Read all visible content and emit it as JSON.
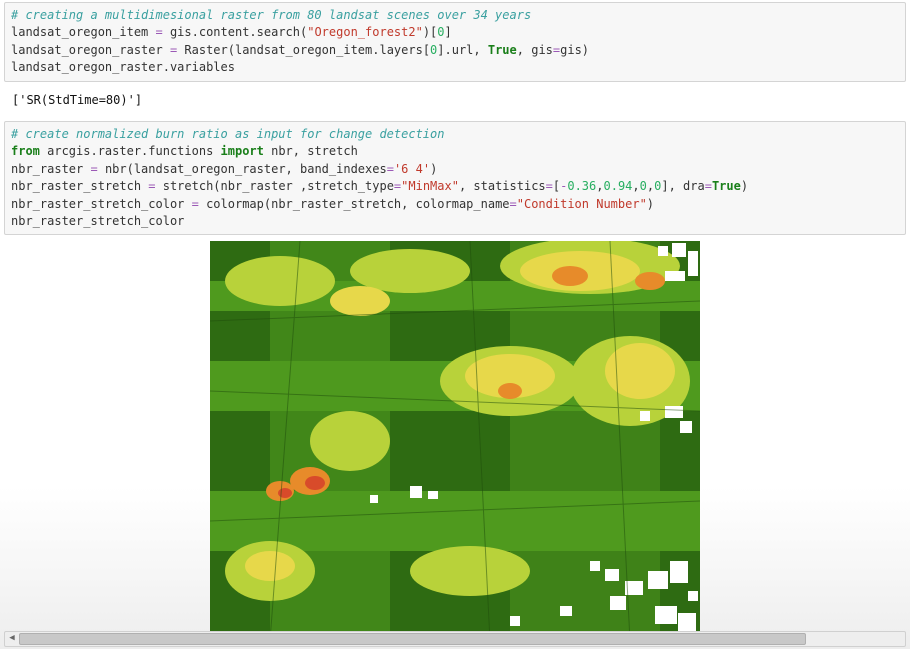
{
  "cell1": {
    "comment": "# creating a multidimesional raster from 80 landsat scenes over 34 years",
    "line2": {
      "lhs": "landsat_oregon_item ",
      "eq": "= ",
      "rhs1": "gis.content.search(",
      "str": "\"Oregon_forest2\"",
      "rhs2": ")[",
      "num": "0",
      "rhs3": "]"
    },
    "line3": {
      "lhs": "landsat_oregon_raster ",
      "eq": "= ",
      "rhs1": "Raster(landsat_oregon_item.layers[",
      "num1": "0",
      "rhs2": "].url, ",
      "kw1": "True",
      "rhs3": ", gis",
      "eq2": "=",
      "rhs4": "gis)"
    },
    "line4": "landsat_oregon_raster.variables"
  },
  "output1": "['SR(StdTime=80)']",
  "cell2": {
    "comment": "# create normalized burn ratio as input for change detection",
    "line2": {
      "kw1": "from ",
      "mod": "arcgis.raster.functions ",
      "kw2": "import ",
      "imp": "nbr, stretch"
    },
    "line3": {
      "lhs": "nbr_raster ",
      "eq": "= ",
      "rhs1": "nbr(landsat_oregon_raster, band_indexes",
      "eq2": "=",
      "str": "'6 4'",
      "rhs2": ")"
    },
    "line4": {
      "lhs": "nbr_raster_stretch ",
      "eq": "= ",
      "rhs1": "stretch(nbr_raster ,stretch_type",
      "eq2": "=",
      "str1": "\"MinMax\"",
      "rhs2": ", statistics",
      "eq3": "=",
      "rhs3": "[",
      "n1": "-",
      "n1b": "0.36",
      "c1": ",",
      "n2": "0.94",
      "c2": ",",
      "n3": "0",
      "c3": ",",
      "n4": "0",
      "rhs4": "], dra",
      "eq4": "=",
      "kw": "True",
      "rhs5": ")"
    },
    "line5": {
      "lhs": "nbr_raster_stretch_color ",
      "eq": "= ",
      "rhs1": "colormap(nbr_raster_stretch, colormap_name",
      "eq2": "=",
      "str": "\"Condition Number\"",
      "rhs2": ")"
    },
    "line6": "nbr_raster_stretch_color"
  },
  "scroll": {
    "left": "◀",
    "right": " "
  }
}
